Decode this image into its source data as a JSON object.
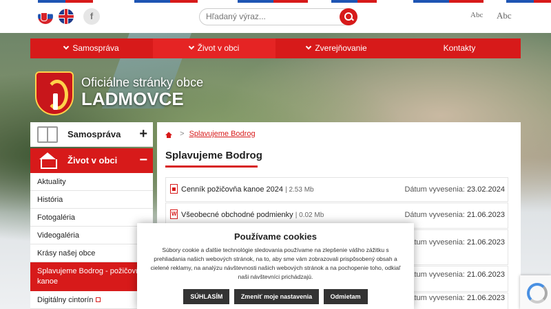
{
  "search": {
    "placeholder": "Hľadaný výraz..."
  },
  "top": {
    "fb": "f",
    "abc_small": "Abc",
    "abc_big": "Abc"
  },
  "menu": {
    "items": [
      "Samospráva",
      "Život v obci",
      "Zverejňovanie",
      "Kontakty"
    ]
  },
  "site": {
    "subtitle": "Oficiálne stránky obce",
    "name": "LADMOVCE"
  },
  "sidebar": {
    "sections": [
      {
        "label": "Samospráva",
        "toggle": "+"
      },
      {
        "label": "Život v obci",
        "toggle": "−"
      }
    ],
    "items": [
      "Aktuality",
      "História",
      "Fotogaléria",
      "Videogaléria",
      "Krásy našej obce",
      "Splavujeme Bodrog - požičovňa kanoe",
      "Digitálny cintorín"
    ]
  },
  "breadcrumb": {
    "sep": ">",
    "current": "Splavujeme Bodrog"
  },
  "page": {
    "title": "Splavujeme Bodrog"
  },
  "files": [
    {
      "name": "Cenník požičovňa kanoe 2024",
      "size": "2.53 Mb",
      "date_label": "Dátum vyvesenia:",
      "date": "23.02.2024"
    },
    {
      "name": "Všeobecné obchodné podmienky",
      "size": "0.02 Mb",
      "date_label": "Dátum vyvesenia:",
      "date": "21.06.2023"
    },
    {
      "date_label": "Dátum vyvesenia:",
      "date": "21.06.2023"
    },
    {
      "date_label": "Dátum vyvesenia:",
      "date": "21.06.2023"
    },
    {
      "date_label": "Dátum vyvesenia:",
      "date": "21.06.2023"
    }
  ],
  "cookie": {
    "title": "Používame cookies",
    "text": "Súbory cookie a ďalšie technológie sledovania používame na zlepšenie vášho zážitku s prehliadania našich webových stránok, na to, aby sme vám zobrazovali prispôsobený obsah a cielené reklamy, na analýzu návštevnosti našich webových stránok a na pochopenie toho, odkiaľ naši návštevníci prichádzajú.",
    "accept": "SÚHLASÍM",
    "settings": "Zmeniť moje nastavenia",
    "reject": "Odmietam"
  },
  "colors": {
    "accent": "#d71a1a",
    "dark_button": "#333333"
  }
}
